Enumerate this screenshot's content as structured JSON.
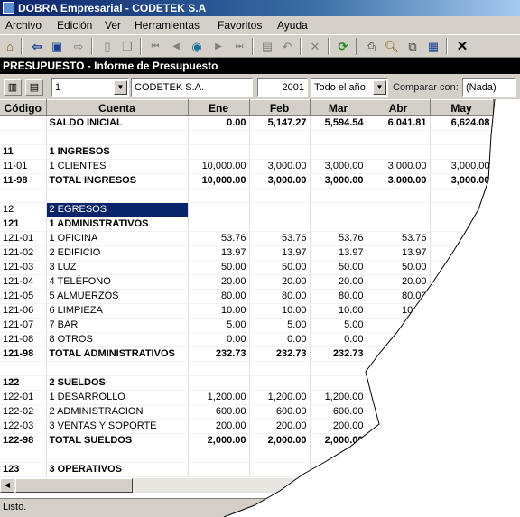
{
  "window": {
    "title": "DOBRA Empresarial - CODETEK S.A"
  },
  "menu": [
    "Archivo",
    "Edición",
    "Ver",
    "Herramientas",
    "Favoritos",
    "Ayuda"
  ],
  "toolbar_icons": [
    "home-icon",
    "back-icon",
    "report-icon",
    "forward-icon",
    "new-doc-icon",
    "copy-icon",
    "first-icon",
    "prev-icon",
    "search-icon",
    "next-icon",
    "last-icon",
    "save-icon",
    "undo-icon",
    "delete-icon",
    "refresh-icon",
    "print-icon",
    "preview-icon",
    "export-icon",
    "save-as-icon",
    "close-icon"
  ],
  "report": {
    "title": "PRESUPUESTO - Informe de Presupuesto"
  },
  "filters": {
    "version": "1",
    "company": "CODETEK S.A.",
    "year": "2001",
    "period": "Todo el año",
    "compare_label": "Comparar con:",
    "compare_value": "(Nada)"
  },
  "table": {
    "columns": [
      "Código",
      "Cuenta",
      "Ene",
      "Feb",
      "Mar",
      "Abr",
      "May"
    ],
    "rows": [
      {
        "code": "",
        "account": "SALDO INICIAL",
        "values": [
          "0.00",
          "5,147.27",
          "5,594.54",
          "6,041.81",
          "6,624.08"
        ],
        "bold": true
      },
      {
        "code": "",
        "account": "",
        "values": [
          "",
          "",
          "",
          "",
          ""
        ]
      },
      {
        "code": "11",
        "account": "1 INGRESOS",
        "values": [
          "",
          "",
          "",
          "",
          ""
        ],
        "bold": true
      },
      {
        "code": "11-01",
        "account": "1 CLIENTES",
        "values": [
          "10,000.00",
          "3,000.00",
          "3,000.00",
          "3,000.00",
          "3,000.00"
        ]
      },
      {
        "code": "11-98",
        "account": "TOTAL INGRESOS",
        "values": [
          "10,000.00",
          "3,000.00",
          "3,000.00",
          "3,000.00",
          "3,000.00"
        ],
        "bold": true
      },
      {
        "code": "",
        "account": "",
        "values": [
          "",
          "",
          "",
          "",
          ""
        ]
      },
      {
        "code": "12",
        "account": "2 EGRESOS",
        "values": [
          "",
          "",
          "",
          "",
          ""
        ],
        "selected": true
      },
      {
        "code": "121",
        "account": "1 ADMINISTRATIVOS",
        "values": [
          "",
          "",
          "",
          "",
          ""
        ],
        "bold": true
      },
      {
        "code": "121-01",
        "account": "1 OFICINA",
        "values": [
          "53.76",
          "53.76",
          "53.76",
          "53.76",
          "53.76"
        ]
      },
      {
        "code": "121-02",
        "account": "2 EDIFICIO",
        "values": [
          "13.97",
          "13.97",
          "13.97",
          "13.97",
          "13.97"
        ]
      },
      {
        "code": "121-03",
        "account": "3 LUZ",
        "values": [
          "50.00",
          "50.00",
          "50.00",
          "50.00",
          "50.00"
        ]
      },
      {
        "code": "121-04",
        "account": "4 TELÉFONO",
        "values": [
          "20.00",
          "20.00",
          "20.00",
          "20.00",
          "20.00"
        ]
      },
      {
        "code": "121-05",
        "account": "5 ALMUERZOS",
        "values": [
          "80.00",
          "80.00",
          "80.00",
          "80.00",
          "80.00"
        ]
      },
      {
        "code": "121-06",
        "account": "6 LIMPIEZA",
        "values": [
          "10.00",
          "10.00",
          "10.00",
          "10.00",
          "10.00"
        ]
      },
      {
        "code": "121-07",
        "account": "7 BAR",
        "values": [
          "5.00",
          "5.00",
          "5.00",
          "5.00",
          "5.00"
        ]
      },
      {
        "code": "121-08",
        "account": "8 OTROS",
        "values": [
          "0.00",
          "0.00",
          "0.00",
          "0.00",
          "0.00"
        ]
      },
      {
        "code": "121-98",
        "account": "TOTAL ADMINISTRATIVOS",
        "values": [
          "232.73",
          "232.73",
          "232.73",
          "232.73",
          "232.73"
        ],
        "bold": true
      },
      {
        "code": "",
        "account": "",
        "values": [
          "",
          "",
          "",
          "",
          ""
        ]
      },
      {
        "code": "122",
        "account": "2 SUELDOS",
        "values": [
          "",
          "",
          "",
          "",
          ""
        ],
        "bold": true
      },
      {
        "code": "122-01",
        "account": "1 DESARROLLO",
        "values": [
          "1,200.00",
          "1,200.00",
          "1,200.00",
          "1,200.00",
          "1,200.00"
        ]
      },
      {
        "code": "122-02",
        "account": "2 ADMINISTRACION",
        "values": [
          "600.00",
          "600.00",
          "600.00",
          "600.00",
          "600.00"
        ]
      },
      {
        "code": "122-03",
        "account": "3 VENTAS Y SOPORTE",
        "values": [
          "200.00",
          "200.00",
          "200.00",
          "200.00",
          "200.00"
        ]
      },
      {
        "code": "122-98",
        "account": "TOTAL SUELDOS",
        "values": [
          "2,000.00",
          "2,000.00",
          "2,000.00",
          "2,000.00",
          "2,000.00"
        ],
        "bold": true
      },
      {
        "code": "",
        "account": "",
        "values": [
          "",
          "",
          "",
          "",
          ""
        ]
      },
      {
        "code": "123",
        "account": "3 OPERATIVOS",
        "values": [
          "",
          "",
          "",
          "",
          ""
        ],
        "bold": true
      }
    ]
  },
  "status": {
    "text": "Listo."
  },
  "colors": {
    "title_start": "#0a246a",
    "selection": "#0a246a",
    "face": "#d4d0c8"
  }
}
